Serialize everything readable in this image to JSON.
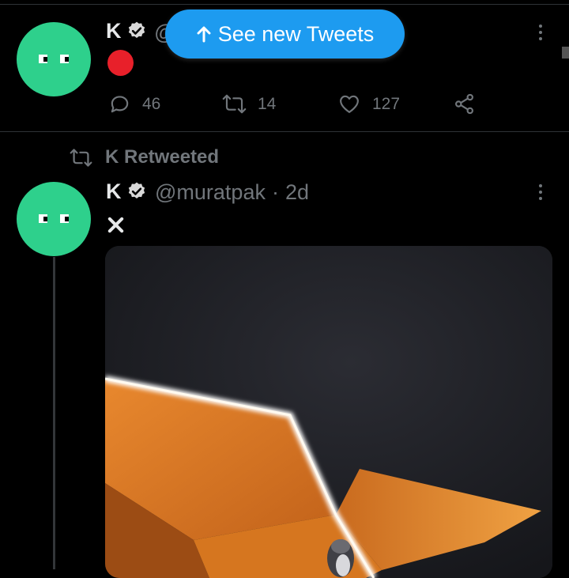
{
  "banner": {
    "label": "See new Tweets",
    "icon": "arrow-up-icon",
    "color": "#1d9bf0"
  },
  "tweet1": {
    "display_name": "K",
    "handle_partial": "@",
    "status_emoji": "red-circle",
    "stats": {
      "replies": "46",
      "retweets": "14",
      "likes": "127"
    }
  },
  "tweet2": {
    "retweeted_by": "K Retweeted",
    "display_name": "K",
    "handle": "@muratpak",
    "separator": "·",
    "time": "2d",
    "body_icon": "cross-mark-icon"
  },
  "colors": {
    "accent": "#1d9bf0",
    "avatar": "#2ed08c",
    "muted": "#71767b",
    "background": "#000000"
  }
}
